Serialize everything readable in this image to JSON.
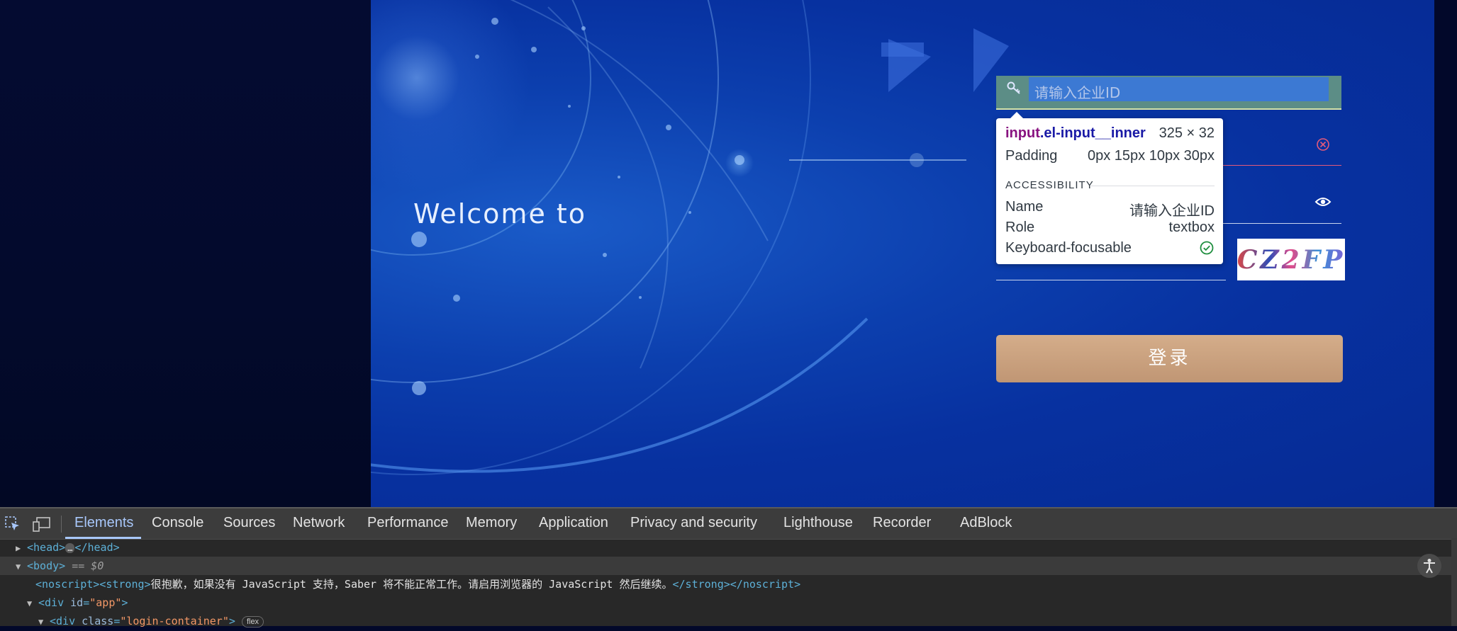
{
  "hero": {
    "welcome": "Welcome to"
  },
  "login": {
    "enterprise_id_placeholder": "请输入企业ID",
    "login_button": "登录",
    "captcha_text": "CZ2FP"
  },
  "tooltip": {
    "selector_tag": "input",
    "selector_class": ".el-input__inner",
    "dimensions": "325 × 32",
    "padding_label": "Padding",
    "padding_value": "0px 15px 10px 30px",
    "accessibility_title": "ACCESSIBILITY",
    "name_label": "Name",
    "name_value": "请输入企业ID",
    "role_label": "Role",
    "role_value": "textbox",
    "focus_label": "Keyboard-focusable"
  },
  "devtools": {
    "tabs": [
      "Elements",
      "Console",
      "Sources",
      "Network",
      "Performance",
      "Memory",
      "Application",
      "Privacy and security",
      "Lighthouse",
      "Recorder",
      "AdBlock"
    ],
    "active_tab": "Elements",
    "dom": {
      "head_open": "<head>",
      "head_close": "</head>",
      "body_tag": "<body>",
      "body_marker": "== $0",
      "noscript_open": "<noscript>",
      "strong_open": "<strong>",
      "noscript_text": "很抱歉，如果没有 JavaScript 支持，Saber 将不能正常工作。请启用浏览器的 JavaScript 然后继续。",
      "strong_close": "</strong>",
      "noscript_close": "</noscript>",
      "div_app_open": "<div ",
      "div_app_attr": "id",
      "div_app_val": "\"app\"",
      "div_login_attr": "class",
      "div_login_val": "\"login-container\"",
      "flex_badge": "flex"
    }
  },
  "colors": {
    "hero_blue": "#0731a0",
    "login_button": "#c9a17e",
    "devtools_bg": "#282828",
    "active_tab": "#a8c7fa"
  }
}
